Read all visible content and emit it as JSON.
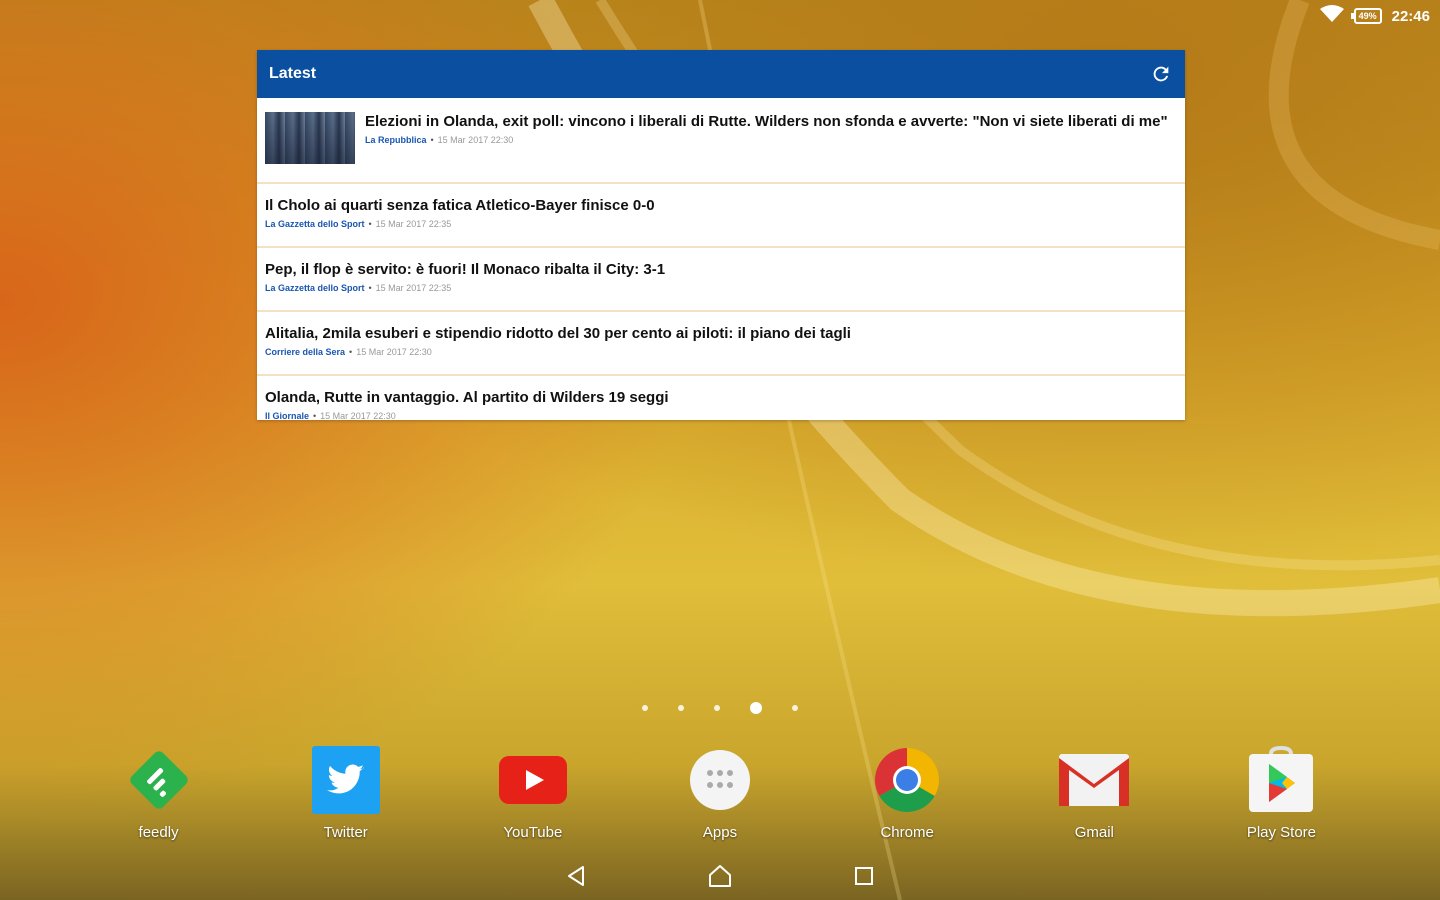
{
  "status_bar": {
    "battery": "49%",
    "time": "22:46"
  },
  "widget": {
    "title": "Latest",
    "articles": [
      {
        "title": "Elezioni in Olanda, exit poll: vincono i liberali di Rutte. Wilders non sfonda e avverte: \"Non vi siete liberati di me\"",
        "source": "La Repubblica",
        "time": "15 Mar 2017 22:30"
      },
      {
        "title": "Il Cholo ai quarti senza fatica Atletico-Bayer finisce 0-0",
        "source": "La Gazzetta dello Sport",
        "time": "15 Mar 2017 22:35"
      },
      {
        "title": "Pep, il flop è servito: è fuori! Il Monaco ribalta il City: 3-1",
        "source": "La Gazzetta dello Sport",
        "time": "15 Mar 2017 22:35"
      },
      {
        "title": "Alitalia, 2mila esuberi e stipendio ridotto del 30 per cento ai piloti: il piano dei tagli",
        "source": "Corriere della Sera",
        "time": "15 Mar 2017 22:30"
      },
      {
        "title": "Olanda, Rutte in vantaggio. Al partito di Wilders 19 seggi",
        "source": "Il Giornale",
        "time": "15 Mar 2017 22:30"
      }
    ]
  },
  "dock": {
    "apps": [
      {
        "label": "feedly",
        "icon": "feedly-icon"
      },
      {
        "label": "Twitter",
        "icon": "twitter-icon"
      },
      {
        "label": "YouTube",
        "icon": "youtube-icon"
      },
      {
        "label": "Apps",
        "icon": "apps-icon"
      },
      {
        "label": "Chrome",
        "icon": "chrome-icon"
      },
      {
        "label": "Gmail",
        "icon": "gmail-icon"
      },
      {
        "label": "Play Store",
        "icon": "play-store-icon"
      }
    ]
  },
  "page_indicator": {
    "count": 5,
    "active": 4
  },
  "colors": {
    "widget_header": "#0a4fa0",
    "source_link": "#1a57b0"
  }
}
